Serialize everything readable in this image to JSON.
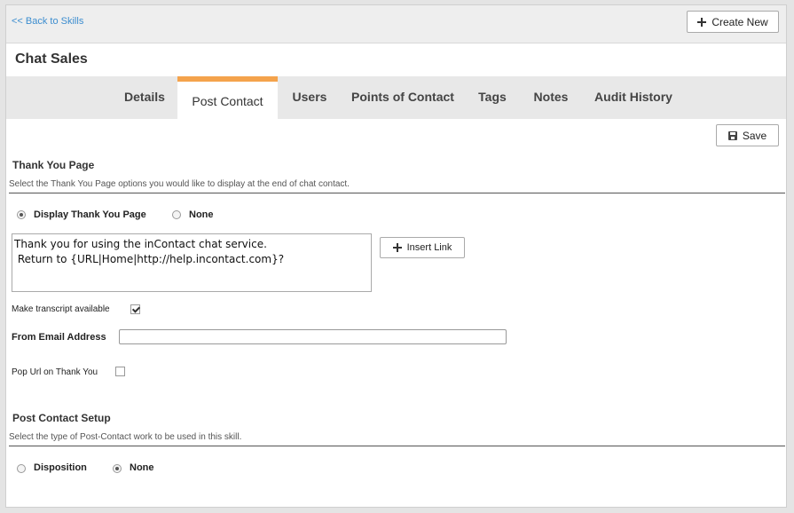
{
  "header": {
    "back_link": "<< Back to Skills",
    "create_new_label": "Create New"
  },
  "page": {
    "title": "Chat Sales"
  },
  "tabs": [
    {
      "label": "Details",
      "active": false
    },
    {
      "label": "Post Contact",
      "active": true
    },
    {
      "label": "Users",
      "active": false
    },
    {
      "label": "Points of Contact",
      "active": false
    },
    {
      "label": "Tags",
      "active": false
    },
    {
      "label": "Notes",
      "active": false
    },
    {
      "label": "Audit History",
      "active": false
    }
  ],
  "toolbar": {
    "save_label": "Save"
  },
  "thank_you": {
    "title": "Thank You Page",
    "description": "Select the Thank You Page options you would like to display at the end of chat contact.",
    "options": [
      {
        "label": "Display Thank You Page",
        "checked": true
      },
      {
        "label": "None",
        "checked": false
      }
    ],
    "message": "Thank you for using the inContact chat service.\n Return to {URL|Home|http://help.incontact.com}?",
    "insert_link_label": "Insert Link",
    "transcript_label": "Make transcript available",
    "transcript_checked": true,
    "from_email_label": "From Email Address",
    "from_email_value": "",
    "pop_url_label": "Pop Url on Thank You",
    "pop_url_checked": false
  },
  "post_contact": {
    "title": "Post Contact Setup",
    "description": "Select the type of Post-Contact work to be used in this skill.",
    "options": [
      {
        "label": "Disposition",
        "checked": false
      },
      {
        "label": "None",
        "checked": true
      }
    ]
  },
  "colors": {
    "accent_tab": "#f4a34c",
    "link": "#3c8dcf"
  },
  "icons": {
    "create_new": "plus-icon",
    "save": "floppy-disk-icon",
    "insert_link": "plus-icon"
  }
}
